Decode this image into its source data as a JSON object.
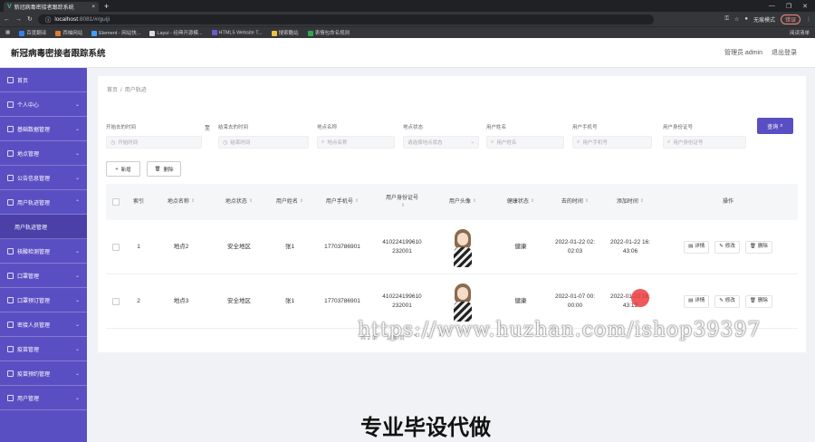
{
  "browser": {
    "tab_title": "新冠病毒密接者跟踪系统",
    "url_host": "localhost",
    "url_rest": ":8081/#/guiji",
    "incognito_label": "无痕模式",
    "error_label": "错误",
    "bookmarks": [
      "百度翻译",
      "西柚网站",
      "Element - 网站快...",
      "Layui - 经典开源模...",
      "HTML5 Website T...",
      "搜索酷站",
      "表情包命名规则"
    ],
    "bookmarks_right": "阅读清单"
  },
  "header": {
    "title": "新冠病毒密接者跟踪系统",
    "user": "管理员 admin",
    "logout": "退出登录"
  },
  "sidebar": {
    "items": [
      {
        "label": "首页",
        "chevron": false
      },
      {
        "label": "个人中心",
        "chevron": true
      },
      {
        "label": "基础数据管理",
        "chevron": true
      },
      {
        "label": "地点管理",
        "chevron": true
      },
      {
        "label": "公告信息管理",
        "chevron": true
      },
      {
        "label": "用户轨迹管理",
        "chevron": true,
        "open": true
      },
      {
        "label": "用户轨迹管理",
        "sub": true
      },
      {
        "label": "核酸检测管理",
        "chevron": true
      },
      {
        "label": "口罩管理",
        "chevron": true
      },
      {
        "label": "口罩预订管理",
        "chevron": true
      },
      {
        "label": "密接人员管理",
        "chevron": true
      },
      {
        "label": "疫苗管理",
        "chevron": true
      },
      {
        "label": "疫苗预约管理",
        "chevron": true
      },
      {
        "label": "用户管理",
        "chevron": true
      }
    ]
  },
  "breadcrumb": {
    "home": "首页",
    "separator": "/",
    "current": "用户轨迹"
  },
  "filters": {
    "range_sep": "至",
    "fields": [
      {
        "label": "开始去的时间",
        "placeholder": "开始时间",
        "icon": "◷"
      },
      {
        "label": "结束去的时间",
        "placeholder": "结束时间",
        "icon": "◷"
      },
      {
        "label": "地点名称",
        "placeholder": "地点名称",
        "icon": "⌕"
      },
      {
        "label": "地点状态",
        "placeholder": "请选择地点状态",
        "icon": ""
      },
      {
        "label": "用户姓名",
        "placeholder": "用户姓名",
        "icon": "⌕"
      },
      {
        "label": "用户手机号",
        "placeholder": "用户手机号",
        "icon": "⌕"
      },
      {
        "label": "用户身份证号",
        "placeholder": "用户身份证号",
        "icon": "⌕"
      }
    ],
    "query_button": "查询"
  },
  "actions": {
    "add": "新增",
    "delete": "删除"
  },
  "table": {
    "headers": [
      "索引",
      "地点名称",
      "地点状态",
      "用户姓名",
      "用户手机号",
      "用户身份证号",
      "用户头像",
      "健康状态",
      "去的时间",
      "添加时间",
      "操作"
    ],
    "rows": [
      {
        "index": "1",
        "place": "地点2",
        "status": "安全地区",
        "name": "张1",
        "phone": "17703786901",
        "id_line1": "410224199610",
        "id_line2": "232001",
        "health": "健康",
        "go_line1": "2022-01-22 02:",
        "go_line2": "02:03",
        "add_line1": "2022-01-22 16:",
        "add_line2": "43:06"
      },
      {
        "index": "2",
        "place": "地点3",
        "status": "安全地区",
        "name": "张1",
        "phone": "17703786901",
        "id_line1": "410224199610",
        "id_line2": "232001",
        "health": "健康",
        "go_line1": "2022-01-07 00:",
        "go_line2": "00:00",
        "add_line1": "2022-01-22 16:",
        "add_line2": "43:13"
      }
    ],
    "row_ops": {
      "detail": "详情",
      "edit": "修改",
      "delete": "删除"
    }
  },
  "pager": {
    "total": "共 2 条",
    "per_page": "10条/页",
    "prev": "<",
    "page": "1",
    "next": ">"
  },
  "overlay": {
    "watermark": "https://www.huzhan.com/ishop39397",
    "promo": "专业毕设代做"
  }
}
